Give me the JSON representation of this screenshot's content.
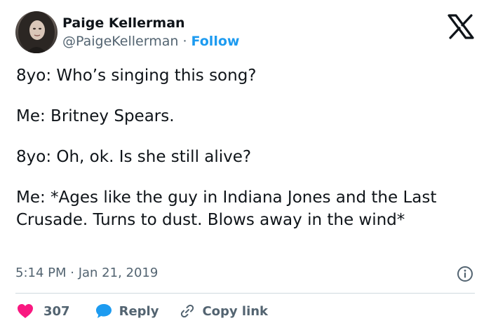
{
  "author": {
    "name": "Paige Kellerman",
    "handle": "@PaigeKellerman",
    "separator": "·",
    "follow_label": "Follow"
  },
  "tweet": {
    "paragraphs": [
      "8yo: Who’s singing this song?",
      "Me: Britney Spears.",
      "8yo: Oh, ok. Is she still alive?",
      "Me: *Ages like the guy in Indiana Jones and the Last Crusade. Turns to dust. Blows away in the wind*"
    ],
    "timestamp": "5:14 PM · Jan 21, 2019"
  },
  "actions": {
    "like_count": "307",
    "reply_label": "Reply",
    "copy_link_label": "Copy link"
  },
  "icons": {
    "brand": "x-logo-icon",
    "info": "info-icon",
    "like": "heart-icon",
    "reply": "speech-bubble-icon",
    "copy": "link-icon"
  },
  "colors": {
    "text": "#0f1419",
    "secondary": "#536471",
    "link": "#1d9bf0",
    "like": "#f91880",
    "divider": "#cfd9de"
  }
}
